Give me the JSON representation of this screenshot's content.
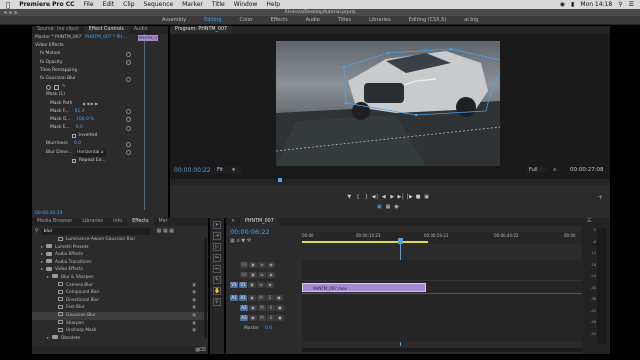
{
  "menubar": {
    "apple": "",
    "items": [
      "Premiere Pro CC",
      "File",
      "Edit",
      "Clip",
      "Sequence",
      "Marker",
      "Title",
      "Window",
      "Help"
    ],
    "clock": "Mon 14:18"
  },
  "window": {
    "title": "/Users/a/Desktop/tutorial.prproj"
  },
  "workspaces": [
    "Assembly",
    "Editing",
    "Color",
    "Effects",
    "Audio",
    "Titles",
    "Libraries",
    "Editing (CS5.5)",
    "al big"
  ],
  "workspace_active_index": 1,
  "effect_controls": {
    "tabs": [
      "Source: (no clips)",
      "Effect Controls",
      "Audio"
    ],
    "master_label": "Master * PHNTM_007",
    "clip_label": "PHNTM_007 * PH...",
    "clip_marker": "PHNTM_0",
    "section_title": "Video Effects",
    "rows": [
      {
        "label": "fx  Motion",
        "value": ""
      },
      {
        "label": "fx  Opacity",
        "value": ""
      },
      {
        "label": "Time Remapping",
        "value": ""
      },
      {
        "label": "fx  Gaussian Blur",
        "value": ""
      },
      {
        "label": "Mask (1)",
        "value": ""
      },
      {
        "label": "Mask Path",
        "value": ""
      },
      {
        "label": "Mask F...",
        "value": "61.0"
      },
      {
        "label": "Mask O...",
        "value": "100.0 %"
      },
      {
        "label": "Mask E...",
        "value": "0.0"
      },
      {
        "label": "",
        "value": "Inverted"
      },
      {
        "label": "Blurriness",
        "value": "0.0"
      },
      {
        "label": "Blur Dime...",
        "value": "Horizontal a"
      },
      {
        "label": "",
        "value": "Repeat Ed..."
      }
    ],
    "timecode": "00:00:06:19"
  },
  "program": {
    "tab": "Program: PHNTM_007",
    "timecode_left": "00:00:00:22",
    "fit": "Fit",
    "quality": "Full",
    "timecode_right": "00:00:27:08"
  },
  "effects_panel": {
    "tabs": [
      "Media Browser",
      "Libraries",
      "Info",
      "Effects",
      "Mar"
    ],
    "search_value": "blur",
    "items": [
      {
        "label": "Luminance-Aware Gaussian Blur",
        "indent": 3,
        "kind": "fx"
      },
      {
        "label": "Lumetri Presets",
        "indent": 1,
        "kind": "folder"
      },
      {
        "label": "Audio Effects",
        "indent": 1,
        "kind": "folder"
      },
      {
        "label": "Audio Transitions",
        "indent": 1,
        "kind": "folder"
      },
      {
        "label": "Video Effects",
        "indent": 1,
        "kind": "folder"
      },
      {
        "label": "Blur & Sharpen",
        "indent": 2,
        "kind": "folder"
      },
      {
        "label": "Camera Blur",
        "indent": 3,
        "kind": "fx"
      },
      {
        "label": "Compound Blur",
        "indent": 3,
        "kind": "fx"
      },
      {
        "label": "Directional Blur",
        "indent": 3,
        "kind": "fx"
      },
      {
        "label": "Fast Blur",
        "indent": 3,
        "kind": "fx"
      },
      {
        "label": "Gaussian Blur",
        "indent": 3,
        "kind": "fx"
      },
      {
        "label": "Sharpen",
        "indent": 3,
        "kind": "fx"
      },
      {
        "label": "Unsharp Mask",
        "indent": 3,
        "kind": "fx"
      },
      {
        "label": "Obsolete",
        "indent": 2,
        "kind": "folder"
      }
    ],
    "selected_index": 10
  },
  "timeline": {
    "tab": "PHNTM_007",
    "timecode": "00:00:06:22",
    "ruler": [
      "00:00",
      "00:00:14:23",
      "00:00:29:23",
      "00:00:44:22",
      "00:00"
    ],
    "video_tracks": [
      "V3",
      "V2",
      "V1"
    ],
    "audio_tracks": [
      "A1",
      "A2",
      "A3"
    ],
    "master_label": "Master",
    "master_value": "0.0",
    "clip_label": "PHNTM_007.mov",
    "playhead_percent": 35
  },
  "meter_labels": [
    "0",
    "-6",
    "-12",
    "-18",
    "-24",
    "-30",
    "-36",
    "-42",
    "-48",
    "-54"
  ]
}
